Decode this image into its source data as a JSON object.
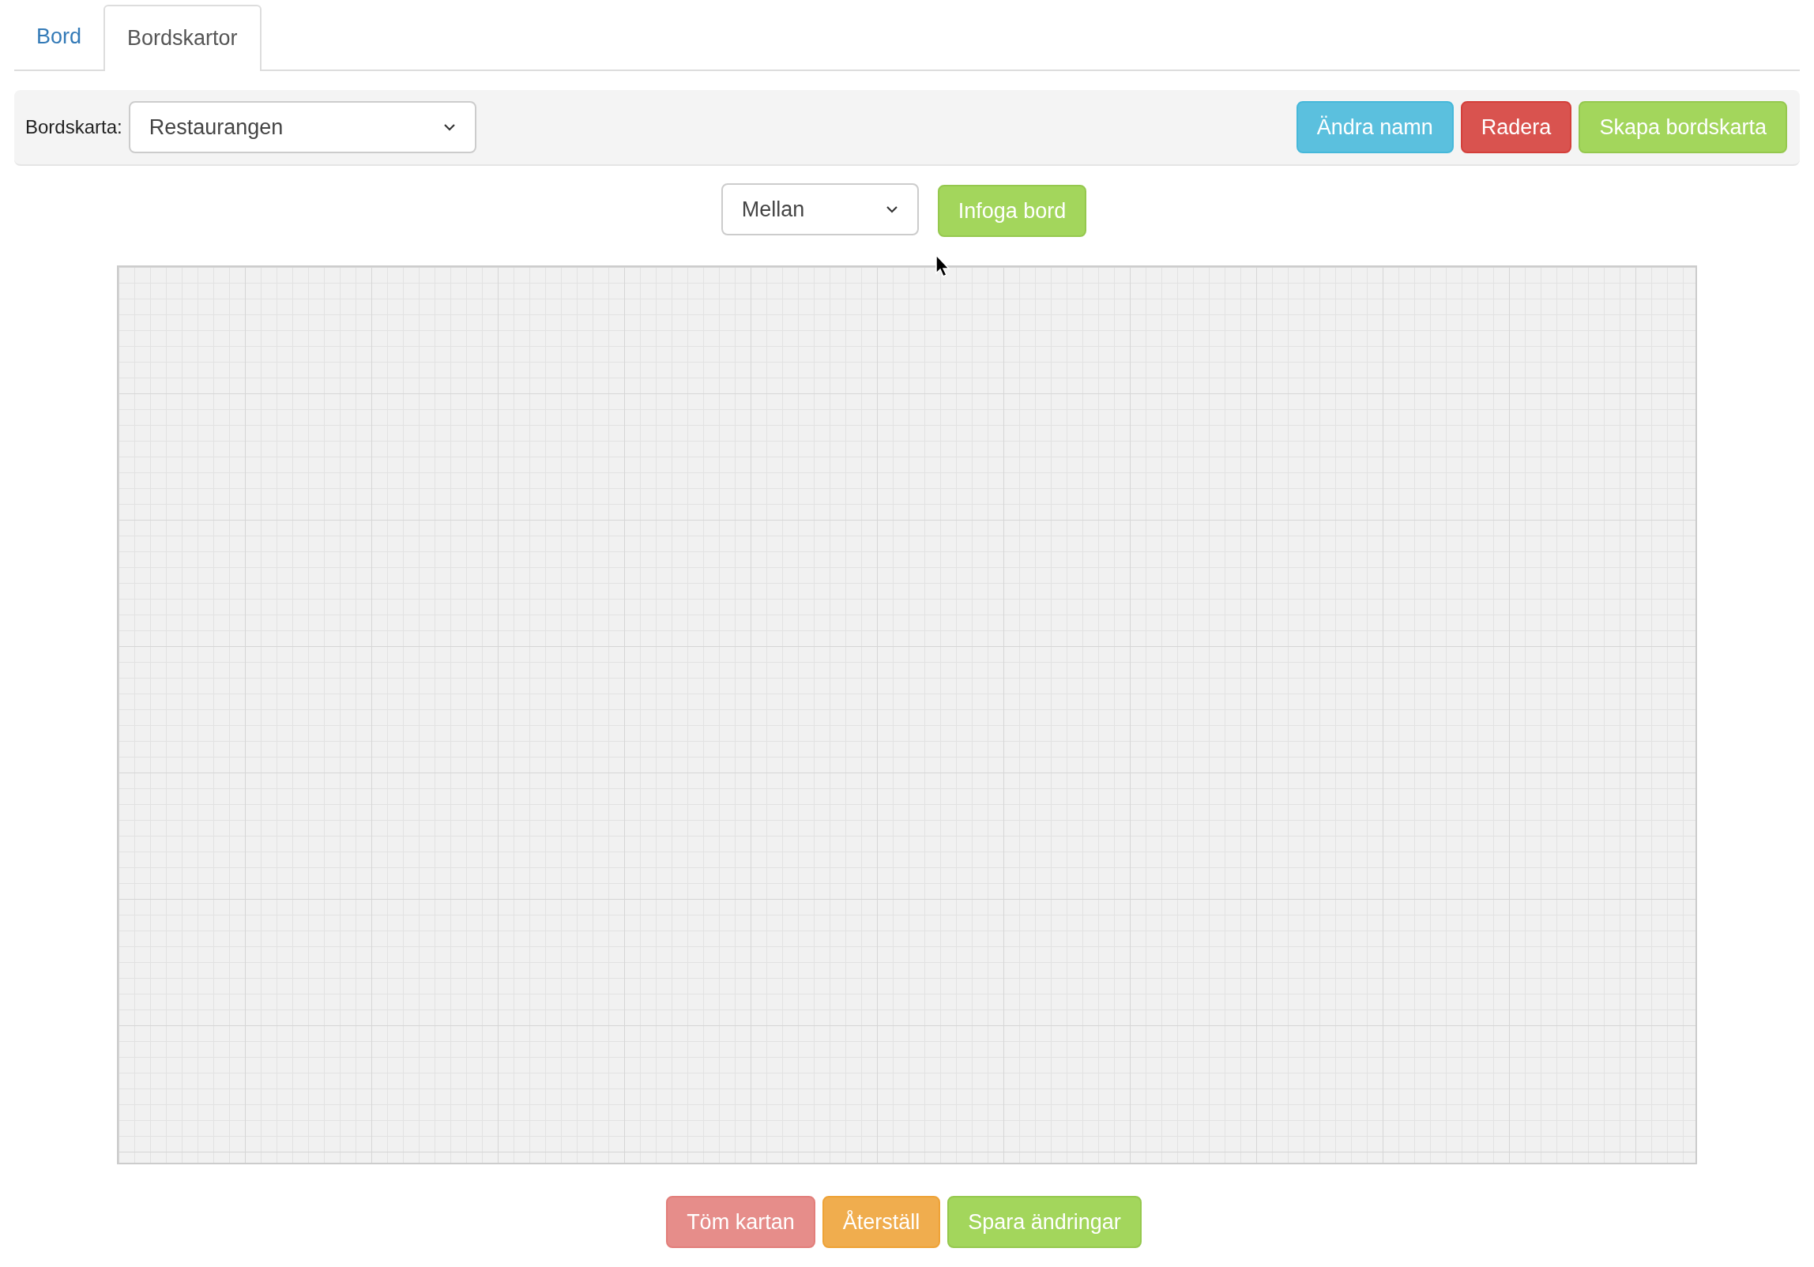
{
  "tabs": [
    {
      "label": "Bord",
      "selected": false
    },
    {
      "label": "Bordskartor",
      "selected": true
    }
  ],
  "toolbar": {
    "label": "Bordskarta:",
    "select": {
      "value": "Restaurangen"
    },
    "buttons": [
      {
        "label": "Ändra namn",
        "kind": "info"
      },
      {
        "label": "Radera",
        "kind": "danger"
      },
      {
        "label": "Skapa bordskarta",
        "kind": "success"
      }
    ]
  },
  "insert": {
    "size_select": {
      "value": "Mellan"
    },
    "button": {
      "label": "Infoga bord",
      "kind": "success"
    }
  },
  "footer": {
    "buttons": [
      {
        "label": "Töm kartan",
        "kind": "faded"
      },
      {
        "label": "Återställ",
        "kind": "warning"
      },
      {
        "label": "Spara ändringar",
        "kind": "success"
      }
    ]
  }
}
